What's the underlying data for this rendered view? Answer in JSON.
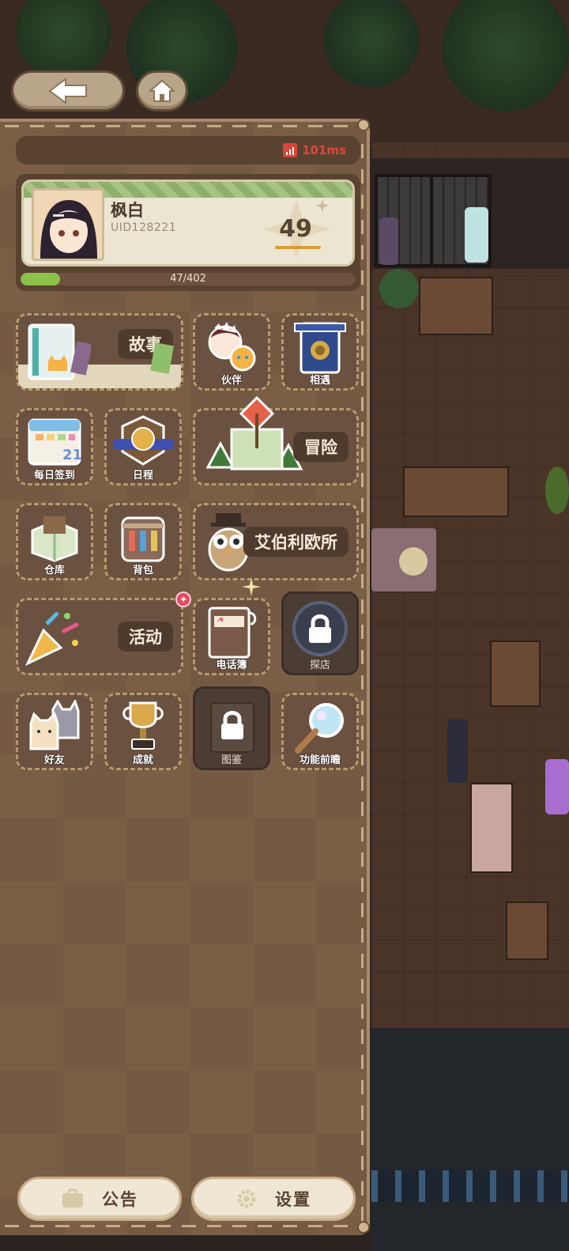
{
  "nav": {
    "back_icon": "arrow-left-icon",
    "home_icon": "home-icon"
  },
  "status": {
    "ping": "101ms",
    "ping_icon": "signal-icon"
  },
  "profile": {
    "name": "枫白",
    "uid": "UID128221",
    "level": "49",
    "xp_text": "47/402",
    "xp_fraction": 0.117
  },
  "menu": {
    "story": "故事",
    "partner": "伙伴",
    "encounter": "相遇",
    "daily_checkin": "每日签到",
    "schedule": "日程",
    "adventure": "冒险",
    "warehouse": "仓库",
    "backpack": "背包",
    "abberley_office": "艾伯利欧所",
    "event": "活动",
    "phonebook": "电话簿",
    "explore": "探店",
    "friends": "好友",
    "achievements": "成就",
    "codex": "图鉴",
    "preview": "功能前瞻"
  },
  "footer": {
    "notice": "公告",
    "settings": "设置"
  },
  "colors": {
    "panel": "#7a5e46",
    "xp": "#8bc24a",
    "ping": "#e0463a",
    "badge": "#e44a62"
  }
}
